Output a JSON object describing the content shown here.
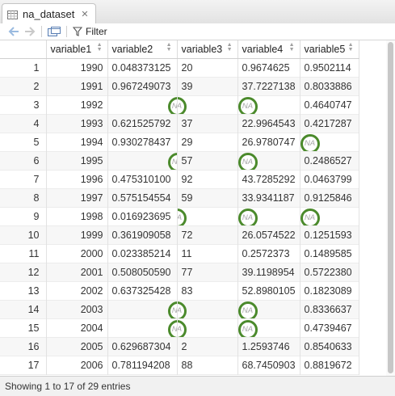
{
  "tab": {
    "title": "na_dataset",
    "close_glyph": "✕"
  },
  "toolbar": {
    "filter_label": "Filter"
  },
  "columns": [
    "",
    "variable1",
    "variable2",
    "variable3",
    "variable4",
    "variable5"
  ],
  "rows": [
    {
      "n": "1",
      "v1": "1990",
      "v2": "0.048373125",
      "v3": "20",
      "v4": "0.9674625",
      "v5": "0.9502114"
    },
    {
      "n": "2",
      "v1": "1991",
      "v2": "0.967249073",
      "v3": "39",
      "v4": "37.7227138",
      "v5": "0.8033886"
    },
    {
      "n": "3",
      "v1": "1992",
      "v2": "NA",
      "v3": "NA",
      "v4": "NA",
      "v5": "0.4640747"
    },
    {
      "n": "4",
      "v1": "1993",
      "v2": "0.621525792",
      "v3": "37",
      "v4": "22.9964543",
      "v5": "0.4217287"
    },
    {
      "n": "5",
      "v1": "1994",
      "v2": "0.930278437",
      "v3": "29",
      "v4": "26.9780747",
      "v5": "NA"
    },
    {
      "n": "6",
      "v1": "1995",
      "v2": "NA",
      "v3": "57",
      "v4": "NA",
      "v5": "0.2486527"
    },
    {
      "n": "7",
      "v1": "1996",
      "v2": "0.475310100",
      "v3": "92",
      "v4": "43.7285292",
      "v5": "0.0463799"
    },
    {
      "n": "8",
      "v1": "1997",
      "v2": "0.575154554",
      "v3": "59",
      "v4": "33.9341187",
      "v5": "0.9125846"
    },
    {
      "n": "9",
      "v1": "1998",
      "v2": "0.016923695",
      "v3": "NA",
      "v4": "NA",
      "v5": "NA"
    },
    {
      "n": "10",
      "v1": "1999",
      "v2": "0.361909058",
      "v3": "72",
      "v4": "26.0574522",
      "v5": "0.1251593"
    },
    {
      "n": "11",
      "v1": "2000",
      "v2": "0.023385214",
      "v3": "11",
      "v4": "0.2572373",
      "v5": "0.1489585"
    },
    {
      "n": "12",
      "v1": "2001",
      "v2": "0.508050590",
      "v3": "77",
      "v4": "39.1198954",
      "v5": "0.5722380"
    },
    {
      "n": "13",
      "v1": "2002",
      "v2": "0.637325428",
      "v3": "83",
      "v4": "52.8980105",
      "v5": "0.1823089"
    },
    {
      "n": "14",
      "v1": "2003",
      "v2": "NA",
      "v3": "NA",
      "v4": "NA",
      "v5": "0.8336637"
    },
    {
      "n": "15",
      "v1": "2004",
      "v2": "NA",
      "v3": "NA",
      "v4": "NA",
      "v5": "0.4739467"
    },
    {
      "n": "16",
      "v1": "2005",
      "v2": "0.629687304",
      "v3": "2",
      "v4": "1.2593746",
      "v5": "0.8540633"
    },
    {
      "n": "17",
      "v1": "2006",
      "v2": "0.781194208",
      "v3": "88",
      "v4": "68.7450903",
      "v5": "0.8819672"
    }
  ],
  "footer": {
    "status": "Showing 1 to 17 of 29 entries"
  },
  "colors": {
    "na_ring": "#4b8a2c",
    "accent": "#3c78c8"
  }
}
